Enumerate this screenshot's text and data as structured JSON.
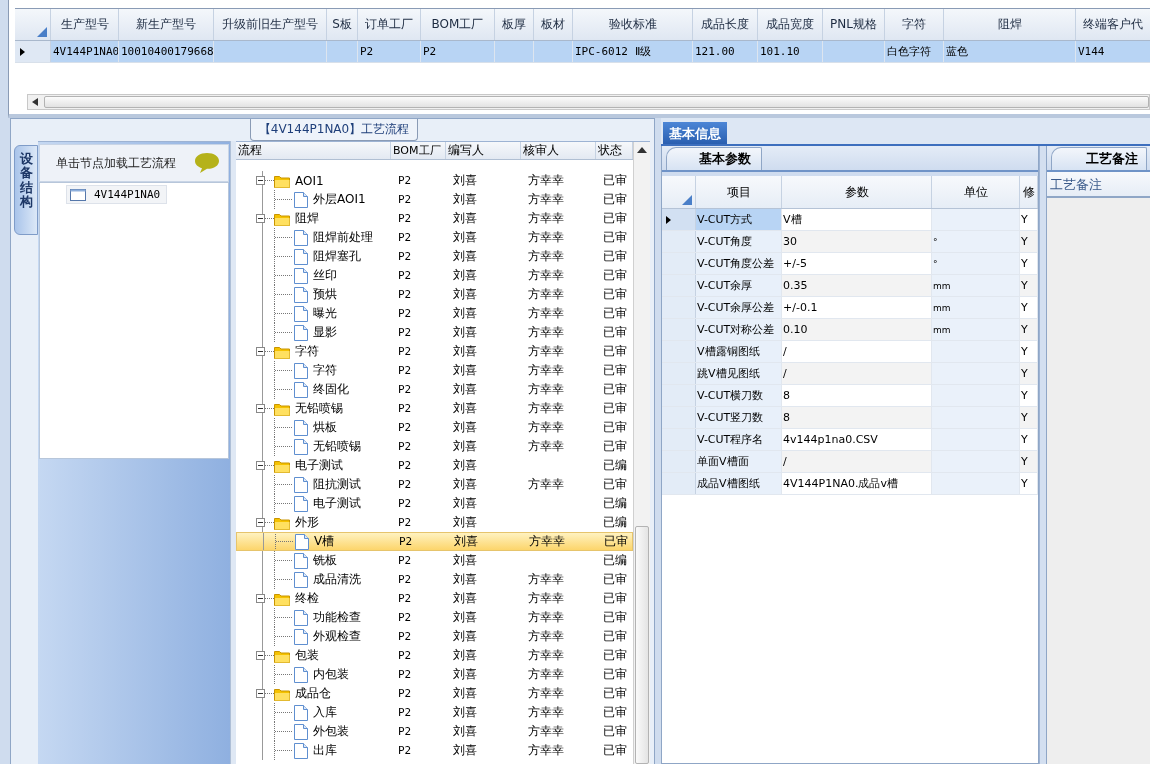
{
  "product_grid": {
    "columns": [
      "生产型号",
      "新生产型号",
      "升级前旧生产型号",
      "S板",
      "订单工厂",
      "BOM工厂",
      "板厚",
      "板材",
      "验收标准",
      "成品长度",
      "成品宽度",
      "PNL规格",
      "字符",
      "阻焊",
      "终端客户代"
    ],
    "rows": [
      {
        "selected": true,
        "cells": [
          "4V144P1NA0",
          "10010400179668",
          null,
          null,
          "P2",
          "P2",
          null,
          null,
          "IPC-6012 Ⅱ级",
          "121.00",
          "101.10",
          null,
          "白色字符",
          "蓝色",
          "V144"
        ]
      }
    ]
  },
  "process_panel": {
    "title": "【4V144P1NA0】工艺流程",
    "side_tab": "设备结构",
    "hint": "单击节点加载工艺流程",
    "structure_nodes": [
      {
        "label": "4V144P1NA0"
      }
    ],
    "flow_grid": {
      "columns": [
        "流程",
        "BOM工厂",
        "编写人",
        "核审人",
        "状态"
      ],
      "rows": [
        {
          "label": "AOI1",
          "bom": "P2",
          "writer": "刘喜",
          "reviewer": "方幸幸",
          "status": "已审",
          "expanded": true,
          "selected": false,
          "children": [
            {
              "label": "外层AOI1",
              "bom": "P2",
              "writer": "刘喜",
              "reviewer": "方幸幸",
              "status": "已审",
              "selected": false
            }
          ]
        },
        {
          "label": "阻焊",
          "bom": "P2",
          "writer": "刘喜",
          "reviewer": "方幸幸",
          "status": "已审",
          "expanded": true,
          "selected": false,
          "children": [
            {
              "label": "阻焊前处理",
              "bom": "P2",
              "writer": "刘喜",
              "reviewer": "方幸幸",
              "status": "已审",
              "selected": false
            },
            {
              "label": "阻焊塞孔",
              "bom": "P2",
              "writer": "刘喜",
              "reviewer": "方幸幸",
              "status": "已审",
              "selected": false
            },
            {
              "label": "丝印",
              "bom": "P2",
              "writer": "刘喜",
              "reviewer": "方幸幸",
              "status": "已审",
              "selected": false
            },
            {
              "label": "预烘",
              "bom": "P2",
              "writer": "刘喜",
              "reviewer": "方幸幸",
              "status": "已审",
              "selected": false
            },
            {
              "label": "曝光",
              "bom": "P2",
              "writer": "刘喜",
              "reviewer": "方幸幸",
              "status": "已审",
              "selected": false
            },
            {
              "label": "显影",
              "bom": "P2",
              "writer": "刘喜",
              "reviewer": "方幸幸",
              "status": "已审",
              "selected": false
            }
          ]
        },
        {
          "label": "字符",
          "bom": "P2",
          "writer": "刘喜",
          "reviewer": "方幸幸",
          "status": "已审",
          "expanded": true,
          "selected": false,
          "children": [
            {
              "label": "字符",
              "bom": "P2",
              "writer": "刘喜",
              "reviewer": "方幸幸",
              "status": "已审",
              "selected": false
            },
            {
              "label": "终固化",
              "bom": "P2",
              "writer": "刘喜",
              "reviewer": "方幸幸",
              "status": "已审",
              "selected": false
            }
          ]
        },
        {
          "label": "无铅喷锡",
          "bom": "P2",
          "writer": "刘喜",
          "reviewer": "方幸幸",
          "status": "已审",
          "expanded": true,
          "selected": false,
          "children": [
            {
              "label": "烘板",
              "bom": "P2",
              "writer": "刘喜",
              "reviewer": "方幸幸",
              "status": "已审",
              "selected": false
            },
            {
              "label": "无铅喷锡",
              "bom": "P2",
              "writer": "刘喜",
              "reviewer": "方幸幸",
              "status": "已审",
              "selected": false
            }
          ]
        },
        {
          "label": "电子测试",
          "bom": "P2",
          "writer": "刘喜",
          "status": "已编",
          "expanded": true,
          "selected": false,
          "children": [
            {
              "label": "阻抗测试",
              "bom": "P2",
              "writer": "刘喜",
              "reviewer": "方幸幸",
              "status": "已审",
              "selected": false
            },
            {
              "label": "电子测试",
              "bom": "P2",
              "writer": "刘喜",
              "status": "已编",
              "selected": false
            }
          ]
        },
        {
          "label": "外形",
          "bom": "P2",
          "writer": "刘喜",
          "status": "已编",
          "expanded": true,
          "selected": false,
          "children": [
            {
              "label": "V槽",
              "bom": "P2",
              "writer": "刘喜",
              "reviewer": "方幸幸",
              "status": "已审",
              "selected": true
            },
            {
              "label": "铣板",
              "bom": "P2",
              "writer": "刘喜",
              "status": "已编",
              "selected": false
            },
            {
              "label": "成品清洗",
              "bom": "P2",
              "writer": "刘喜",
              "reviewer": "方幸幸",
              "status": "已审",
              "selected": false
            }
          ]
        },
        {
          "label": "终检",
          "bom": "P2",
          "writer": "刘喜",
          "reviewer": "方幸幸",
          "status": "已审",
          "expanded": true,
          "selected": false,
          "children": [
            {
              "label": "功能检查",
              "bom": "P2",
              "writer": "刘喜",
              "reviewer": "方幸幸",
              "status": "已审",
              "selected": false
            },
            {
              "label": "外观检查",
              "bom": "P2",
              "writer": "刘喜",
              "reviewer": "方幸幸",
              "status": "已审",
              "selected": false
            }
          ]
        },
        {
          "label": "包装",
          "bom": "P2",
          "writer": "刘喜",
          "reviewer": "方幸幸",
          "status": "已审",
          "expanded": true,
          "selected": false,
          "children": [
            {
              "label": "内包装",
              "bom": "P2",
              "writer": "刘喜",
              "reviewer": "方幸幸",
              "status": "已审",
              "selected": false
            }
          ]
        },
        {
          "label": "成品仓",
          "bom": "P2",
          "writer": "刘喜",
          "reviewer": "方幸幸",
          "status": "已审",
          "expanded": true,
          "selected": false,
          "children": [
            {
              "label": "入库",
              "bom": "P2",
              "writer": "刘喜",
              "reviewer": "方幸幸",
              "status": "已审",
              "selected": false
            },
            {
              "label": "外包装",
              "bom": "P2",
              "writer": "刘喜",
              "reviewer": "方幸幸",
              "status": "已审",
              "selected": false
            },
            {
              "label": "出库",
              "bom": "P2",
              "writer": "刘喜",
              "reviewer": "方幸幸",
              "status": "已审",
              "selected": false
            }
          ]
        }
      ]
    }
  },
  "info_panel": {
    "tabs": [
      {
        "label": "基本信息",
        "selected": true
      }
    ],
    "sub_tab": "基本参数",
    "param_grid": {
      "columns": [
        "项目",
        "参数",
        "单位",
        "修"
      ],
      "rows": [
        {
          "item": "V-CUT方式",
          "value": "V槽",
          "modify": "Y",
          "selected": true
        },
        {
          "item": "V-CUT角度",
          "value": "30",
          "unit": "°",
          "modify": "Y",
          "selected": false
        },
        {
          "item": "V-CUT角度公差",
          "value": "+/-5",
          "unit": "°",
          "modify": "Y",
          "selected": false
        },
        {
          "item": "V-CUT余厚",
          "value": "0.35",
          "unit": "mm",
          "modify": "Y",
          "selected": false
        },
        {
          "item": "V-CUT余厚公差",
          "value": "+/-0.1",
          "unit": "mm",
          "modify": "Y",
          "selected": false
        },
        {
          "item": "V-CUT对称公差",
          "value": "0.10",
          "unit": "mm",
          "modify": "Y",
          "selected": false
        },
        {
          "item": "V槽露铜图纸",
          "value": "/",
          "modify": "Y",
          "selected": false
        },
        {
          "item": "跳V槽见图纸",
          "value": "/",
          "modify": "Y",
          "selected": false
        },
        {
          "item": "V-CUT横刀数",
          "value": "8",
          "modify": "Y",
          "selected": false
        },
        {
          "item": "V-CUT竖刀数",
          "value": "8",
          "modify": "Y",
          "selected": false
        },
        {
          "item": "V-CUT程序名",
          "value": "4v144p1na0.CSV",
          "modify": "Y",
          "selected": false
        },
        {
          "item": "单面V槽面",
          "value": "/",
          "modify": "Y",
          "selected": false
        },
        {
          "item": "成品V槽图纸",
          "value": "4V144P1NA0.成品v槽",
          "modify": "Y",
          "selected": false
        }
      ]
    },
    "remarks": {
      "tab": "工艺备注",
      "label": "工艺备注"
    }
  }
}
